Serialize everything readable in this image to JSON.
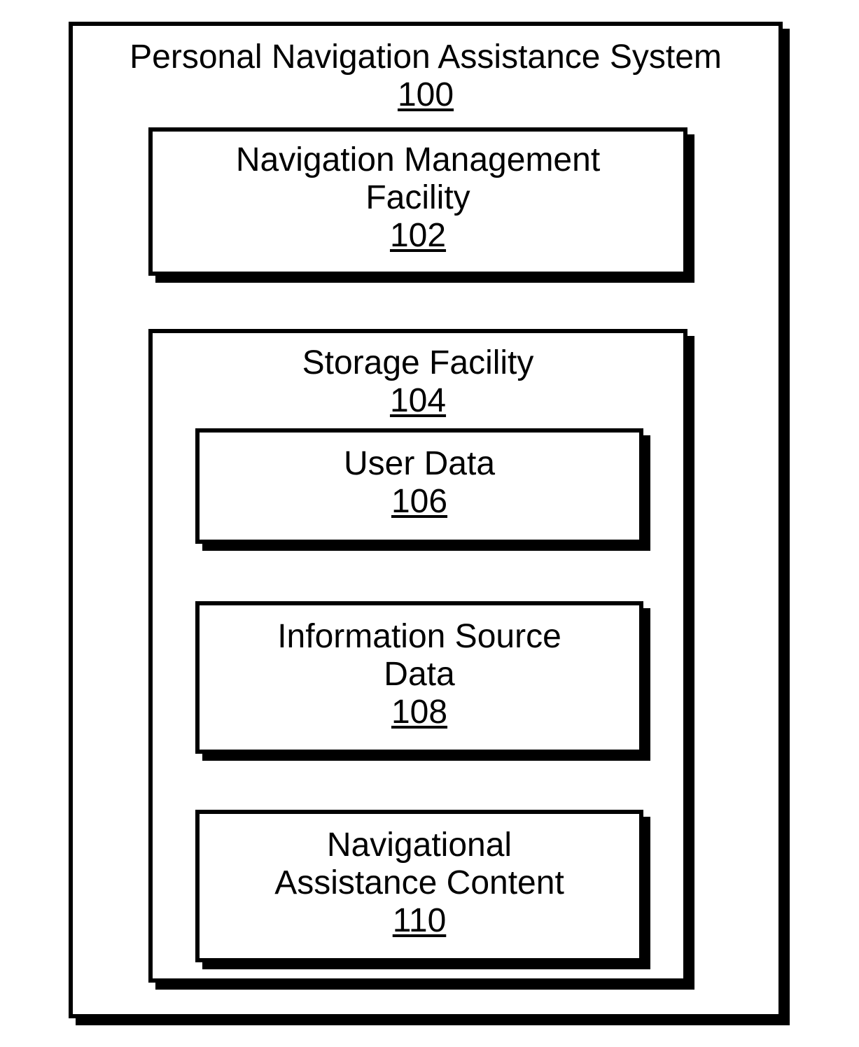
{
  "outer": {
    "title": "Personal Navigation Assistance System",
    "num": "100"
  },
  "navmgmt": {
    "title_line1": "Navigation Management",
    "title_line2": "Facility",
    "num": "102"
  },
  "storage": {
    "title": "Storage Facility",
    "num": "104"
  },
  "user_data": {
    "title": "User Data",
    "num": "106"
  },
  "info_source": {
    "title_line1": "Information Source",
    "title_line2": "Data",
    "num": "108"
  },
  "nav_assist": {
    "title_line1": "Navigational",
    "title_line2": "Assistance Content",
    "num": "110"
  }
}
